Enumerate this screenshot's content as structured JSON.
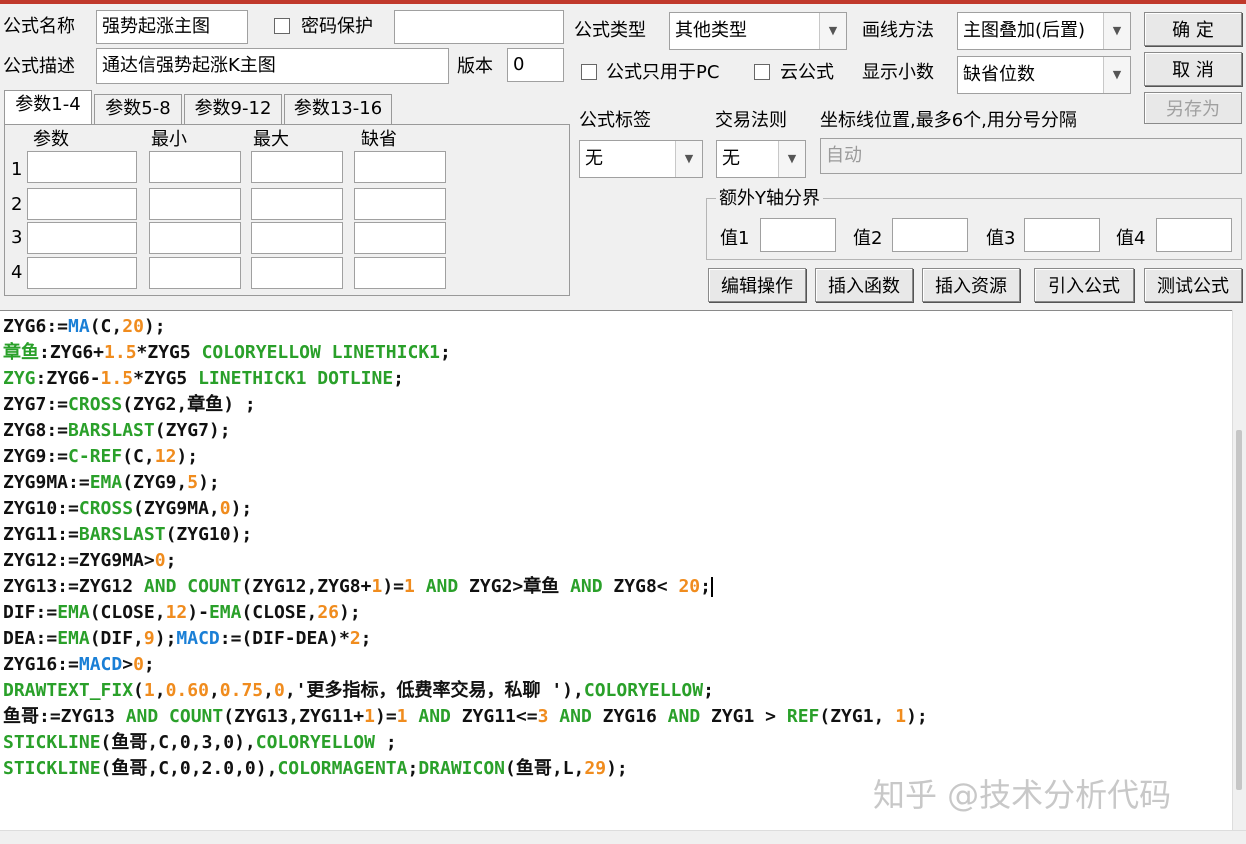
{
  "form": {
    "name_label": "公式名称",
    "name_value": "强势起涨主图",
    "password_label": "密码保护",
    "desc_label": "公式描述",
    "desc_value": "通达信强势起涨K主图",
    "version_label": "版本",
    "version_value": "0",
    "type_label": "公式类型",
    "type_value": "其他类型",
    "draw_label": "画线方法",
    "draw_value": "主图叠加(后置)",
    "pc_only_label": "公式只用于PC",
    "cloud_label": "云公式",
    "decimal_label": "显示小数",
    "decimal_value": "缺省位数",
    "tag_label": "公式标签",
    "tag_value": "无",
    "trade_label": "交易法则",
    "trade_value": "无",
    "axis_label": "坐标线位置,最多6个,用分号分隔",
    "axis_value": "自动",
    "extra_y_label": "额外Y轴分界",
    "val1": "值1",
    "val2": "值2",
    "val3": "值3",
    "val4": "值4"
  },
  "buttons": {
    "ok": "确  定",
    "cancel": "取  消",
    "save_as": "另存为",
    "edit": "编辑操作",
    "insert_func": "插入函数",
    "insert_res": "插入资源",
    "import": "引入公式",
    "test": "测试公式"
  },
  "tabs": [
    "参数1-4",
    "参数5-8",
    "参数9-12",
    "参数13-16"
  ],
  "params": {
    "headers": [
      "参数",
      "最小",
      "最大",
      "缺省"
    ],
    "rows": [
      "1",
      "2",
      "3",
      "4"
    ]
  },
  "code_lines": [
    [
      [
        "ZYG6:=",
        ""
      ],
      [
        "MA",
        "#1a7fd6"
      ],
      [
        "(C,",
        ""
      ],
      [
        "20",
        "#f08c1e"
      ],
      [
        ");",
        ""
      ]
    ],
    [
      [
        "章鱼",
        "#2aa02a"
      ],
      [
        ":ZYG6+",
        ""
      ],
      [
        "1.5",
        "#f08c1e"
      ],
      [
        "*ZYG5 ",
        ""
      ],
      [
        "COLORYELLOW LINETHICK1",
        "#2aa02a"
      ],
      [
        ";",
        ""
      ]
    ],
    [
      [
        "ZYG",
        "#2aa02a"
      ],
      [
        ":ZYG6-",
        ""
      ],
      [
        "1.5",
        "#f08c1e"
      ],
      [
        "*ZYG5 ",
        ""
      ],
      [
        "LINETHICK1 DOTLINE",
        "#2aa02a"
      ],
      [
        ";",
        ""
      ]
    ],
    [
      [
        "ZYG7:=",
        ""
      ],
      [
        "CROSS",
        "#2aa02a"
      ],
      [
        "(ZYG2,章鱼) ;",
        ""
      ]
    ],
    [
      [
        "ZYG8:=",
        ""
      ],
      [
        "BARSLAST",
        "#2aa02a"
      ],
      [
        "(ZYG7);",
        ""
      ]
    ],
    [
      [
        "ZYG9:=",
        ""
      ],
      [
        "C-REF",
        "#2aa02a"
      ],
      [
        "(C,",
        ""
      ],
      [
        "12",
        "#f08c1e"
      ],
      [
        ");",
        ""
      ]
    ],
    [
      [
        "ZYG9MA:=",
        ""
      ],
      [
        "EMA",
        "#2aa02a"
      ],
      [
        "(ZYG9,",
        ""
      ],
      [
        "5",
        "#f08c1e"
      ],
      [
        ");",
        ""
      ]
    ],
    [
      [
        "ZYG10:=",
        ""
      ],
      [
        "CROSS",
        "#2aa02a"
      ],
      [
        "(ZYG9MA,",
        ""
      ],
      [
        "0",
        "#f08c1e"
      ],
      [
        ");",
        ""
      ]
    ],
    [
      [
        "ZYG11:=",
        ""
      ],
      [
        "BARSLAST",
        "#2aa02a"
      ],
      [
        "(ZYG10);",
        ""
      ]
    ],
    [
      [
        "ZYG12:=ZYG9MA>",
        ""
      ],
      [
        "0",
        "#f08c1e"
      ],
      [
        ";",
        ""
      ]
    ],
    [
      [
        "ZYG13:=ZYG12 ",
        ""
      ],
      [
        "AND COUNT",
        "#2aa02a"
      ],
      [
        "(ZYG12,ZYG8+",
        ""
      ],
      [
        "1",
        "#f08c1e"
      ],
      [
        ")=",
        ""
      ],
      [
        "1",
        "#f08c1e"
      ],
      [
        " ",
        ""
      ],
      [
        "AND",
        "#2aa02a"
      ],
      [
        " ZYG2>章鱼 ",
        ""
      ],
      [
        "AND",
        "#2aa02a"
      ],
      [
        " ZYG8< ",
        ""
      ],
      [
        "20",
        "#f08c1e"
      ],
      [
        ";",
        ""
      ]
    ],
    [
      [
        "DIF:=",
        ""
      ],
      [
        "EMA",
        "#2aa02a"
      ],
      [
        "(CLOSE,",
        ""
      ],
      [
        "12",
        "#f08c1e"
      ],
      [
        ")-",
        ""
      ],
      [
        "EMA",
        "#2aa02a"
      ],
      [
        "(CLOSE,",
        ""
      ],
      [
        "26",
        "#f08c1e"
      ],
      [
        ");",
        ""
      ]
    ],
    [
      [
        "DEA:=",
        ""
      ],
      [
        "EMA",
        "#2aa02a"
      ],
      [
        "(DIF,",
        ""
      ],
      [
        "9",
        "#f08c1e"
      ],
      [
        ");",
        ""
      ],
      [
        "MACD",
        "#1a7fd6"
      ],
      [
        ":=(DIF-DEA)*",
        ""
      ],
      [
        "2",
        "#f08c1e"
      ],
      [
        ";",
        ""
      ]
    ],
    [
      [
        "ZYG16:=",
        ""
      ],
      [
        "MACD",
        "#1a7fd6"
      ],
      [
        ">",
        ""
      ],
      [
        "0",
        "#f08c1e"
      ],
      [
        ";",
        ""
      ]
    ],
    [
      [
        "DRAWTEXT_FIX",
        "#2aa02a"
      ],
      [
        "(",
        ""
      ],
      [
        "1",
        "#f08c1e"
      ],
      [
        ",",
        ""
      ],
      [
        "0.60",
        "#f08c1e"
      ],
      [
        ",",
        ""
      ],
      [
        "0.75",
        "#f08c1e"
      ],
      [
        ",",
        ""
      ],
      [
        "0",
        "#f08c1e"
      ],
      [
        ",'更多指标，低费率交易，私聊 '),",
        ""
      ],
      [
        "COLORYELLOW",
        "#2aa02a"
      ],
      [
        ";",
        ""
      ]
    ],
    [
      [
        "鱼哥:=ZYG13 ",
        ""
      ],
      [
        "AND COUNT",
        "#2aa02a"
      ],
      [
        "(ZYG13,ZYG11+",
        ""
      ],
      [
        "1",
        "#f08c1e"
      ],
      [
        ")=",
        ""
      ],
      [
        "1",
        "#f08c1e"
      ],
      [
        " ",
        ""
      ],
      [
        "AND",
        "#2aa02a"
      ],
      [
        " ZYG11<=",
        ""
      ],
      [
        "3",
        "#f08c1e"
      ],
      [
        " ",
        ""
      ],
      [
        "AND",
        "#2aa02a"
      ],
      [
        " ZYG16 ",
        ""
      ],
      [
        "AND",
        "#2aa02a"
      ],
      [
        " ZYG1 > ",
        ""
      ],
      [
        "REF",
        "#2aa02a"
      ],
      [
        "(ZYG1, ",
        ""
      ],
      [
        "1",
        "#f08c1e"
      ],
      [
        ");",
        ""
      ]
    ],
    [
      [
        "STICKLINE",
        "#2aa02a"
      ],
      [
        "(鱼哥,C,0,3,0),",
        ""
      ],
      [
        "COLORYELLOW",
        "#2aa02a"
      ],
      [
        " ;",
        ""
      ]
    ],
    [
      [
        "STICKLINE",
        "#2aa02a"
      ],
      [
        "(鱼哥,C,0,2.0,0),",
        ""
      ],
      [
        "COLORMAGENTA",
        "#2aa02a"
      ],
      [
        ";",
        ""
      ],
      [
        "DRAWICON",
        "#2aa02a"
      ],
      [
        "(鱼哥,L,",
        ""
      ],
      [
        "29",
        "#f08c1e"
      ],
      [
        ");",
        ""
      ]
    ]
  ],
  "watermark": "知乎 @技术分析代码",
  "colors": {
    "accent_red": "#c0392b",
    "keyword_green": "#2aa02a",
    "number_orange": "#f08c1e",
    "func_blue": "#1a7fd6"
  }
}
